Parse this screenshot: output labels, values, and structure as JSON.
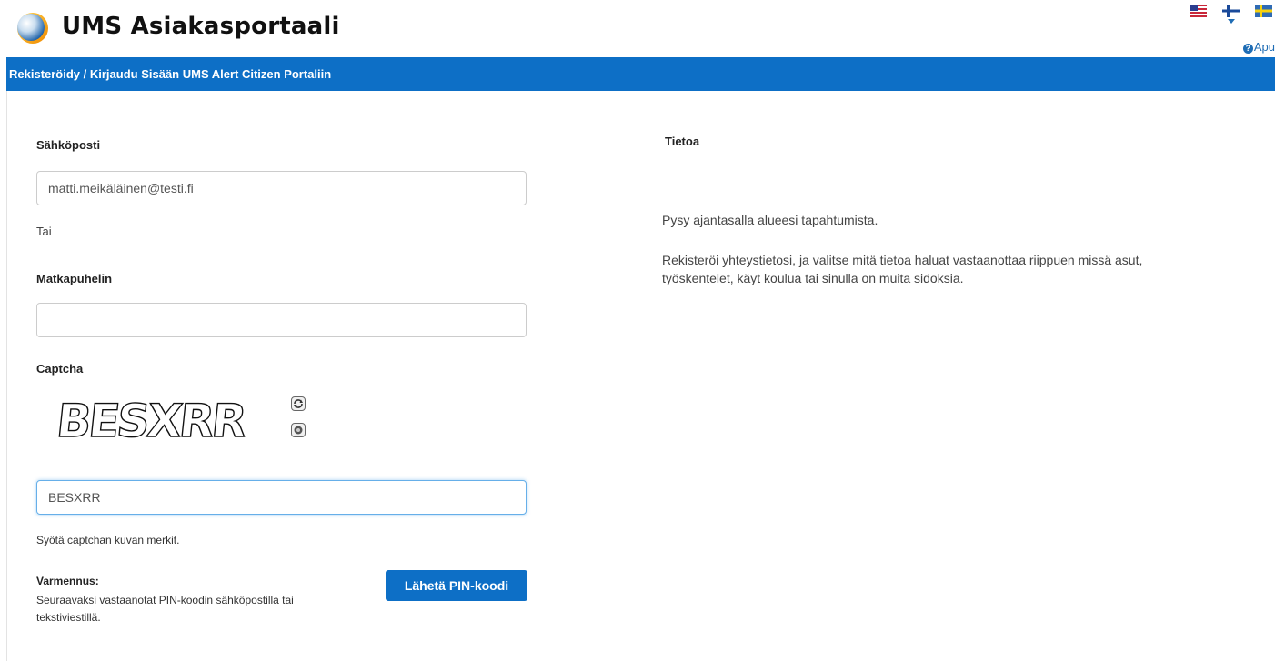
{
  "header": {
    "app_title": "UMS Asiakasportaali",
    "help_label": "Apu",
    "languages": [
      "english-flag-icon",
      "finnish-flag-icon",
      "swedish-flag-icon"
    ]
  },
  "banner": {
    "title": "Rekisteröidy / Kirjaudu Sisään UMS Alert Citizen Portaliin"
  },
  "form": {
    "email_label": "Sähköposti",
    "email_value": "matti.meikäläinen@testi.fi",
    "or_text": "Tai",
    "phone_label": "Matkapuhelin",
    "phone_value": "",
    "captcha_label": "Captcha",
    "captcha_image_text": "BESXRR",
    "captcha_value": "BESXRR",
    "captcha_hint": "Syötä captchan kuvan merkit.",
    "verification_label": "Varmennus:",
    "verification_text_line1": "Seuraavaksi vastaanotat PIN-koodin sähköpostilla tai",
    "verification_text_line2": "tekstiviestillä.",
    "send_pin_button": "Lähetä PIN-koodi"
  },
  "info": {
    "title": "Tietoa",
    "paragraph1": "Pysy ajantasalla alueesi tapahtumista.",
    "paragraph2_line1": "Rekisteröi yhteystietosi, ja valitse mitä tietoa haluat vastaanottaa riippuen missä asut,",
    "paragraph2_line2": "työskentelet, käyt koulua tai sinulla on muita sidoksia."
  },
  "colors": {
    "brand_blue": "#0d6fc6",
    "link_blue": "#1f6db5"
  }
}
